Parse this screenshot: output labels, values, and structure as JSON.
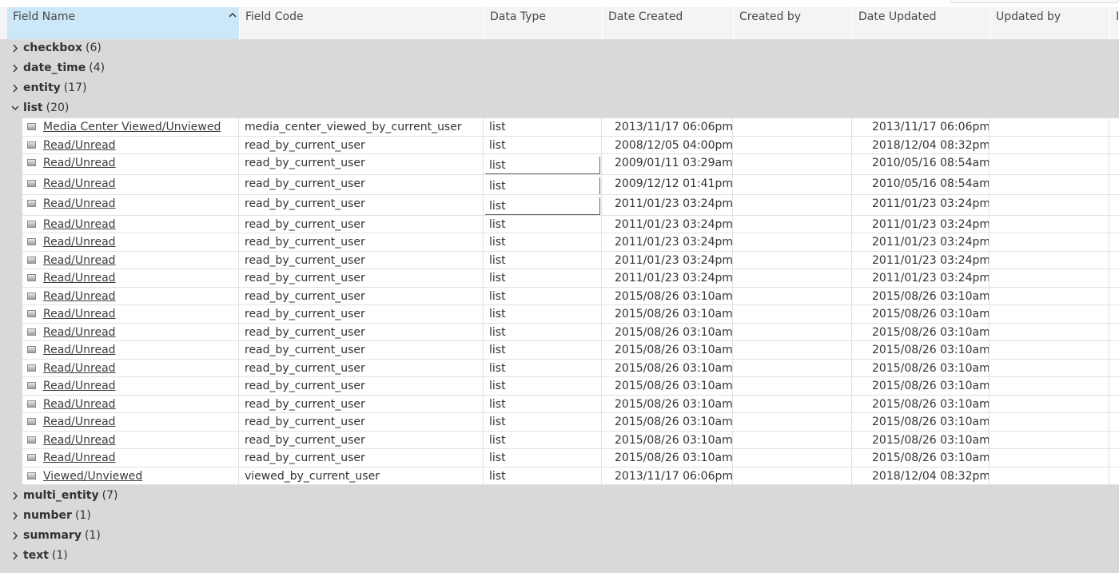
{
  "header": {
    "columns": [
      {
        "key": "field_name",
        "label": "Field Name"
      },
      {
        "key": "field_code",
        "label": "Field Code"
      },
      {
        "key": "data_type",
        "label": "Data Type"
      },
      {
        "key": "date_created",
        "label": "Date Created"
      },
      {
        "key": "created_by",
        "label": "Created by"
      },
      {
        "key": "date_updated",
        "label": "Date Updated"
      },
      {
        "key": "updated_by",
        "label": "Updated by"
      },
      {
        "key": "extra",
        "label": "D"
      }
    ],
    "sort_icon": "chevron-up-icon"
  },
  "groups_before": [
    {
      "name": "checkbox",
      "count": "(6)",
      "expanded": false
    },
    {
      "name": "date_time",
      "count": "(4)",
      "expanded": false
    },
    {
      "name": "entity",
      "count": "(17)",
      "expanded": false
    }
  ],
  "expanded_group": {
    "name": "list",
    "count": "(20)",
    "expanded": true
  },
  "groups_after": [
    {
      "name": "multi_entity",
      "count": "(7)",
      "expanded": false
    },
    {
      "name": "number",
      "count": "(1)",
      "expanded": false
    },
    {
      "name": "summary",
      "count": "(1)",
      "expanded": false
    },
    {
      "name": "text",
      "count": "(1)",
      "expanded": false
    }
  ],
  "row_icon": "field-icon",
  "rows": [
    {
      "name": "Media Center Viewed/Unviewed",
      "code": "media_center_viewed_by_current_user",
      "type": "list",
      "created": "2013/11/17 06:06pm",
      "created_by": "",
      "updated": "2013/11/17 06:06pm",
      "updated_by": "",
      "boxed": false
    },
    {
      "name": "Read/Unread",
      "code": "read_by_current_user",
      "type": "list",
      "created": "2008/12/05 04:00pm",
      "created_by": "",
      "updated": "2018/12/04 08:32pm",
      "updated_by": "",
      "boxed": false
    },
    {
      "name": "Read/Unread",
      "code": "read_by_current_user",
      "type": "list",
      "created": "2009/01/11 03:29am",
      "created_by": "",
      "updated": "2010/05/16 08:54am",
      "updated_by": "",
      "boxed": true
    },
    {
      "name": "Read/Unread",
      "code": "read_by_current_user",
      "type": "list",
      "created": "2009/12/12 01:41pm",
      "created_by": "",
      "updated": "2010/05/16 08:54am",
      "updated_by": "",
      "boxed": true
    },
    {
      "name": "Read/Unread",
      "code": "read_by_current_user",
      "type": "list",
      "created": "2011/01/23 03:24pm",
      "created_by": "",
      "updated": "2011/01/23 03:24pm",
      "updated_by": "",
      "boxed": true
    },
    {
      "name": "Read/Unread",
      "code": "read_by_current_user",
      "type": "list",
      "created": "2011/01/23 03:24pm",
      "created_by": "",
      "updated": "2011/01/23 03:24pm",
      "updated_by": "",
      "boxed": false
    },
    {
      "name": "Read/Unread",
      "code": "read_by_current_user",
      "type": "list",
      "created": "2011/01/23 03:24pm",
      "created_by": "",
      "updated": "2011/01/23 03:24pm",
      "updated_by": "",
      "boxed": false
    },
    {
      "name": "Read/Unread",
      "code": "read_by_current_user",
      "type": "list",
      "created": "2011/01/23 03:24pm",
      "created_by": "",
      "updated": "2011/01/23 03:24pm",
      "updated_by": "",
      "boxed": false
    },
    {
      "name": "Read/Unread",
      "code": "read_by_current_user",
      "type": "list",
      "created": "2011/01/23 03:24pm",
      "created_by": "",
      "updated": "2011/01/23 03:24pm",
      "updated_by": "",
      "boxed": false
    },
    {
      "name": "Read/Unread",
      "code": "read_by_current_user",
      "type": "list",
      "created": "2015/08/26 03:10am",
      "created_by": "",
      "updated": "2015/08/26 03:10am",
      "updated_by": "",
      "boxed": false
    },
    {
      "name": "Read/Unread",
      "code": "read_by_current_user",
      "type": "list",
      "created": "2015/08/26 03:10am",
      "created_by": "",
      "updated": "2015/08/26 03:10am",
      "updated_by": "",
      "boxed": false
    },
    {
      "name": "Read/Unread",
      "code": "read_by_current_user",
      "type": "list",
      "created": "2015/08/26 03:10am",
      "created_by": "",
      "updated": "2015/08/26 03:10am",
      "updated_by": "",
      "boxed": false
    },
    {
      "name": "Read/Unread",
      "code": "read_by_current_user",
      "type": "list",
      "created": "2015/08/26 03:10am",
      "created_by": "",
      "updated": "2015/08/26 03:10am",
      "updated_by": "",
      "boxed": false
    },
    {
      "name": "Read/Unread",
      "code": "read_by_current_user",
      "type": "list",
      "created": "2015/08/26 03:10am",
      "created_by": "",
      "updated": "2015/08/26 03:10am",
      "updated_by": "",
      "boxed": false
    },
    {
      "name": "Read/Unread",
      "code": "read_by_current_user",
      "type": "list",
      "created": "2015/08/26 03:10am",
      "created_by": "",
      "updated": "2015/08/26 03:10am",
      "updated_by": "",
      "boxed": false
    },
    {
      "name": "Read/Unread",
      "code": "read_by_current_user",
      "type": "list",
      "created": "2015/08/26 03:10am",
      "created_by": "",
      "updated": "2015/08/26 03:10am",
      "updated_by": "",
      "boxed": false
    },
    {
      "name": "Read/Unread",
      "code": "read_by_current_user",
      "type": "list",
      "created": "2015/08/26 03:10am",
      "created_by": "",
      "updated": "2015/08/26 03:10am",
      "updated_by": "",
      "boxed": false
    },
    {
      "name": "Read/Unread",
      "code": "read_by_current_user",
      "type": "list",
      "created": "2015/08/26 03:10am",
      "created_by": "",
      "updated": "2015/08/26 03:10am",
      "updated_by": "",
      "boxed": false
    },
    {
      "name": "Read/Unread",
      "code": "read_by_current_user",
      "type": "list",
      "created": "2015/08/26 03:10am",
      "created_by": "",
      "updated": "2015/08/26 03:10am",
      "updated_by": "",
      "boxed": false
    },
    {
      "name": "Viewed/Unviewed",
      "code": "viewed_by_current_user",
      "type": "list",
      "created": "2013/11/17 06:06pm",
      "created_by": "",
      "updated": "2018/12/04 08:32pm",
      "updated_by": "",
      "boxed": false
    }
  ]
}
